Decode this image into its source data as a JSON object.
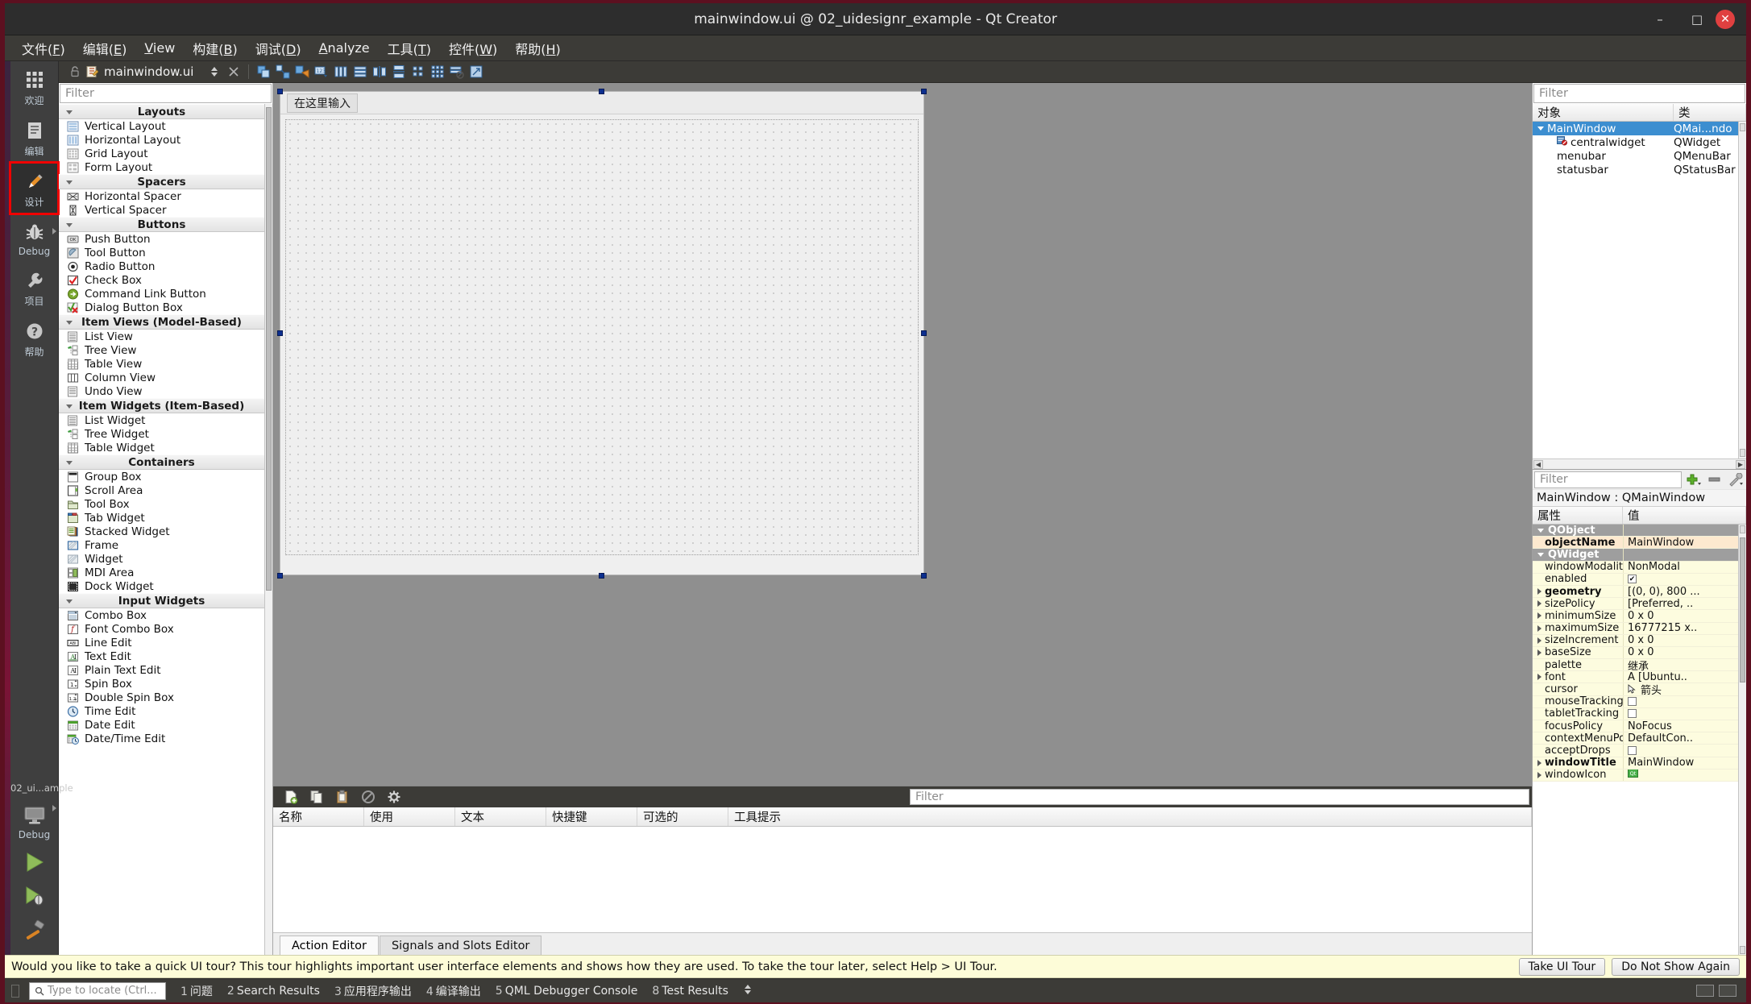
{
  "window": {
    "title": "mainwindow.ui @ 02_uidesignr_example - Qt Creator",
    "minimize": "–",
    "maximize": "□",
    "close": "✕"
  },
  "menubar": {
    "items": [
      {
        "label": "文件(F)",
        "mnemonic": "F"
      },
      {
        "label": "编辑(E)",
        "mnemonic": "E"
      },
      {
        "label": "View",
        "mnemonic": "V"
      },
      {
        "label": "构建(B)",
        "mnemonic": "B"
      },
      {
        "label": "调试(D)",
        "mnemonic": "D"
      },
      {
        "label": "Analyze",
        "mnemonic": "A"
      },
      {
        "label": "工具(T)",
        "mnemonic": "T"
      },
      {
        "label": "控件(W)",
        "mnemonic": "W"
      },
      {
        "label": "帮助(H)",
        "mnemonic": "H"
      }
    ]
  },
  "modebar": {
    "items": [
      {
        "label": "欢迎",
        "icon": "grid-icon",
        "active": false,
        "highlight": false,
        "arrow": false
      },
      {
        "label": "编辑",
        "icon": "edit-document-icon",
        "active": false,
        "highlight": false,
        "arrow": false
      },
      {
        "label": "设计",
        "icon": "pencil-icon",
        "active": true,
        "highlight": true,
        "arrow": false
      },
      {
        "label": "Debug",
        "icon": "bug-icon",
        "active": false,
        "highlight": false,
        "arrow": true
      },
      {
        "label": "项目",
        "icon": "wrench-icon",
        "active": false,
        "highlight": false,
        "arrow": false
      },
      {
        "label": "帮助",
        "icon": "question-mark-icon",
        "active": false,
        "highlight": false,
        "arrow": false
      }
    ],
    "project_label": "02_ui...ample",
    "kit_label": "Debug",
    "run_button": "run-icon",
    "debug_button": "debug-run-icon",
    "build_button": "hammer-icon"
  },
  "editorbar": {
    "lock_icon": "unlocked-icon",
    "file_icon": "ui-file-icon",
    "document": "mainwindow.ui",
    "nav_icon": "updown-arrow-icon",
    "close_icon": "close-document-icon",
    "designer_tools": [
      "edit-widgets-icon",
      "edit-signals-slots-icon",
      "edit-buddies-icon",
      "edit-tab-order-icon",
      "layout-horizontally-icon",
      "layout-vertically-icon",
      "layout-splitter-horizontal-icon",
      "layout-splitter-vertical-icon",
      "layout-form-icon",
      "layout-grid-icon",
      "break-layout-icon",
      "adjust-size-icon"
    ]
  },
  "widgetbox": {
    "filter_placeholder": "Filter",
    "categories": [
      {
        "name": "Layouts",
        "items": [
          {
            "label": "Vertical Layout",
            "icon": "vertical-layout-icon"
          },
          {
            "label": "Horizontal Layout",
            "icon": "horizontal-layout-icon"
          },
          {
            "label": "Grid Layout",
            "icon": "grid-layout-icon"
          },
          {
            "label": "Form Layout",
            "icon": "form-layout-icon"
          }
        ]
      },
      {
        "name": "Spacers",
        "items": [
          {
            "label": "Horizontal Spacer",
            "icon": "horizontal-spacer-icon"
          },
          {
            "label": "Vertical Spacer",
            "icon": "vertical-spacer-icon"
          }
        ]
      },
      {
        "name": "Buttons",
        "items": [
          {
            "label": "Push Button",
            "icon": "push-button-icon"
          },
          {
            "label": "Tool Button",
            "icon": "tool-button-icon"
          },
          {
            "label": "Radio Button",
            "icon": "radio-button-icon"
          },
          {
            "label": "Check Box",
            "icon": "check-box-icon"
          },
          {
            "label": "Command Link Button",
            "icon": "command-link-button-icon"
          },
          {
            "label": "Dialog Button Box",
            "icon": "dialog-button-box-icon"
          }
        ]
      },
      {
        "name": "Item Views (Model-Based)",
        "items": [
          {
            "label": "List View",
            "icon": "list-view-icon"
          },
          {
            "label": "Tree View",
            "icon": "tree-view-icon"
          },
          {
            "label": "Table View",
            "icon": "table-view-icon"
          },
          {
            "label": "Column View",
            "icon": "column-view-icon"
          },
          {
            "label": "Undo View",
            "icon": "undo-view-icon"
          }
        ]
      },
      {
        "name": "Item Widgets (Item-Based)",
        "items": [
          {
            "label": "List Widget",
            "icon": "list-widget-icon"
          },
          {
            "label": "Tree Widget",
            "icon": "tree-widget-icon"
          },
          {
            "label": "Table Widget",
            "icon": "table-widget-icon"
          }
        ]
      },
      {
        "name": "Containers",
        "items": [
          {
            "label": "Group Box",
            "icon": "group-box-icon"
          },
          {
            "label": "Scroll Area",
            "icon": "scroll-area-icon"
          },
          {
            "label": "Tool Box",
            "icon": "tool-box-icon"
          },
          {
            "label": "Tab Widget",
            "icon": "tab-widget-icon"
          },
          {
            "label": "Stacked Widget",
            "icon": "stacked-widget-icon"
          },
          {
            "label": "Frame",
            "icon": "frame-icon"
          },
          {
            "label": "Widget",
            "icon": "widget-icon"
          },
          {
            "label": "MDI Area",
            "icon": "mdi-area-icon"
          },
          {
            "label": "Dock Widget",
            "icon": "dock-widget-icon"
          }
        ]
      },
      {
        "name": "Input Widgets",
        "items": [
          {
            "label": "Combo Box",
            "icon": "combo-box-icon"
          },
          {
            "label": "Font Combo Box",
            "icon": "font-combo-box-icon"
          },
          {
            "label": "Line Edit",
            "icon": "line-edit-icon"
          },
          {
            "label": "Text Edit",
            "icon": "text-edit-icon"
          },
          {
            "label": "Plain Text Edit",
            "icon": "plain-text-edit-icon"
          },
          {
            "label": "Spin Box",
            "icon": "spin-box-icon"
          },
          {
            "label": "Double Spin Box",
            "icon": "double-spin-box-icon"
          },
          {
            "label": "Time Edit",
            "icon": "time-edit-icon"
          },
          {
            "label": "Date Edit",
            "icon": "date-edit-icon"
          },
          {
            "label": "Date/Time Edit",
            "icon": "date-time-edit-icon"
          }
        ]
      }
    ]
  },
  "canvas": {
    "menu_hint": "在这里输入",
    "form_width": 800,
    "form_height": 601
  },
  "action_editor": {
    "toolbar_icons": [
      "new-action-icon",
      "copy-icon",
      "paste-icon",
      "delete-icon",
      "edit-action-icon"
    ],
    "filter_placeholder": "Filter",
    "columns": [
      "名称",
      "使用",
      "文本",
      "快捷键",
      "可选的",
      "工具提示"
    ],
    "rows": [],
    "tabs": [
      {
        "label": "Action Editor",
        "active": true
      },
      {
        "label": "Signals and Slots Editor",
        "active": false
      }
    ]
  },
  "object_inspector": {
    "filter_placeholder": "Filter",
    "columns": [
      "对象",
      "类"
    ],
    "rows": [
      {
        "name": "MainWindow",
        "class": "QMai...ndo",
        "indent": 0,
        "selected": true,
        "expander": true,
        "icon": ""
      },
      {
        "name": "centralwidget",
        "class": "QWidget",
        "indent": 1,
        "selected": false,
        "expander": false,
        "icon": "central-widget-icon"
      },
      {
        "name": "menubar",
        "class": "QMenuBar",
        "indent": 1,
        "selected": false,
        "expander": false,
        "icon": ""
      },
      {
        "name": "statusbar",
        "class": "QStatusBar",
        "indent": 1,
        "selected": false,
        "expander": false,
        "icon": ""
      }
    ]
  },
  "property_editor": {
    "filter_placeholder": "Filter",
    "add_icon": "add-icon",
    "remove_icon": "remove-icon",
    "config_icon": "configure-icon",
    "object_line": "MainWindow : QMainWindow",
    "columns": [
      "属性",
      "值"
    ],
    "rows": [
      {
        "name": "QObject",
        "value": "",
        "type": "group",
        "expanded": true
      },
      {
        "name": "objectName",
        "value": "MainWindow",
        "type": "prop",
        "bold": true,
        "highlight": true
      },
      {
        "name": "QWidget",
        "value": "",
        "type": "group",
        "expanded": true
      },
      {
        "name": "windowModality",
        "value": "NonModal",
        "type": "prop"
      },
      {
        "name": "enabled",
        "value": "✔",
        "type": "check",
        "checked": true
      },
      {
        "name": "geometry",
        "value": "[(0, 0), 800 ...",
        "type": "prop",
        "bold": true,
        "expander": true
      },
      {
        "name": "sizePolicy",
        "value": "[Preferred, ..",
        "type": "prop",
        "expander": true
      },
      {
        "name": "minimumSize",
        "value": "0 x 0",
        "type": "prop",
        "expander": true
      },
      {
        "name": "maximumSize",
        "value": "16777215 x..",
        "type": "prop",
        "expander": true
      },
      {
        "name": "sizeIncrement",
        "value": "0 x 0",
        "type": "prop",
        "expander": true
      },
      {
        "name": "baseSize",
        "value": "0 x 0",
        "type": "prop",
        "expander": true
      },
      {
        "name": "palette",
        "value": "继承",
        "type": "prop"
      },
      {
        "name": "font",
        "value": "A  [Ubuntu..",
        "type": "prop",
        "expander": true
      },
      {
        "name": "cursor",
        "value": "箭头",
        "type": "cursor"
      },
      {
        "name": "mouseTracking",
        "value": "",
        "type": "check",
        "checked": false
      },
      {
        "name": "tabletTracking",
        "value": "",
        "type": "check",
        "checked": false
      },
      {
        "name": "focusPolicy",
        "value": "NoFocus",
        "type": "prop"
      },
      {
        "name": "contextMenuPo...",
        "value": "DefaultCon..",
        "type": "prop"
      },
      {
        "name": "acceptDrops",
        "value": "",
        "type": "check",
        "checked": false
      },
      {
        "name": "windowTitle",
        "value": "MainWindow",
        "type": "prop",
        "bold": true,
        "expander": true
      },
      {
        "name": "windowIcon",
        "value": "qt-icon",
        "type": "icon",
        "expander": true
      }
    ]
  },
  "infobar": {
    "text": "Would you like to take a quick UI tour? This tour highlights important user interface elements and shows how they are used. To take the tour later, select Help > UI Tour.",
    "buttons": [
      {
        "label": "Take UI Tour"
      },
      {
        "label": "Do Not Show Again"
      }
    ]
  },
  "statusbar": {
    "locator_placeholder": "Type to locate (Ctrl...",
    "search_icon": "search-icon",
    "panes": [
      {
        "num": "1",
        "label": "问题"
      },
      {
        "num": "2",
        "label": "Search Results"
      },
      {
        "num": "3",
        "label": "应用程序输出"
      },
      {
        "num": "4",
        "label": "编译输出"
      },
      {
        "num": "5",
        "label": "QML Debugger Console"
      },
      {
        "num": "8",
        "label": "Test Results"
      }
    ],
    "expand_icon": "updown-arrow-icon"
  },
  "colors": {
    "accent_selection": "#3c8ed0",
    "highlight_box": "#f00202",
    "property_bg": "#fdfcdf",
    "property_alt_bg": "#fde9cf",
    "infobar_bg": "#fdfcd8"
  }
}
